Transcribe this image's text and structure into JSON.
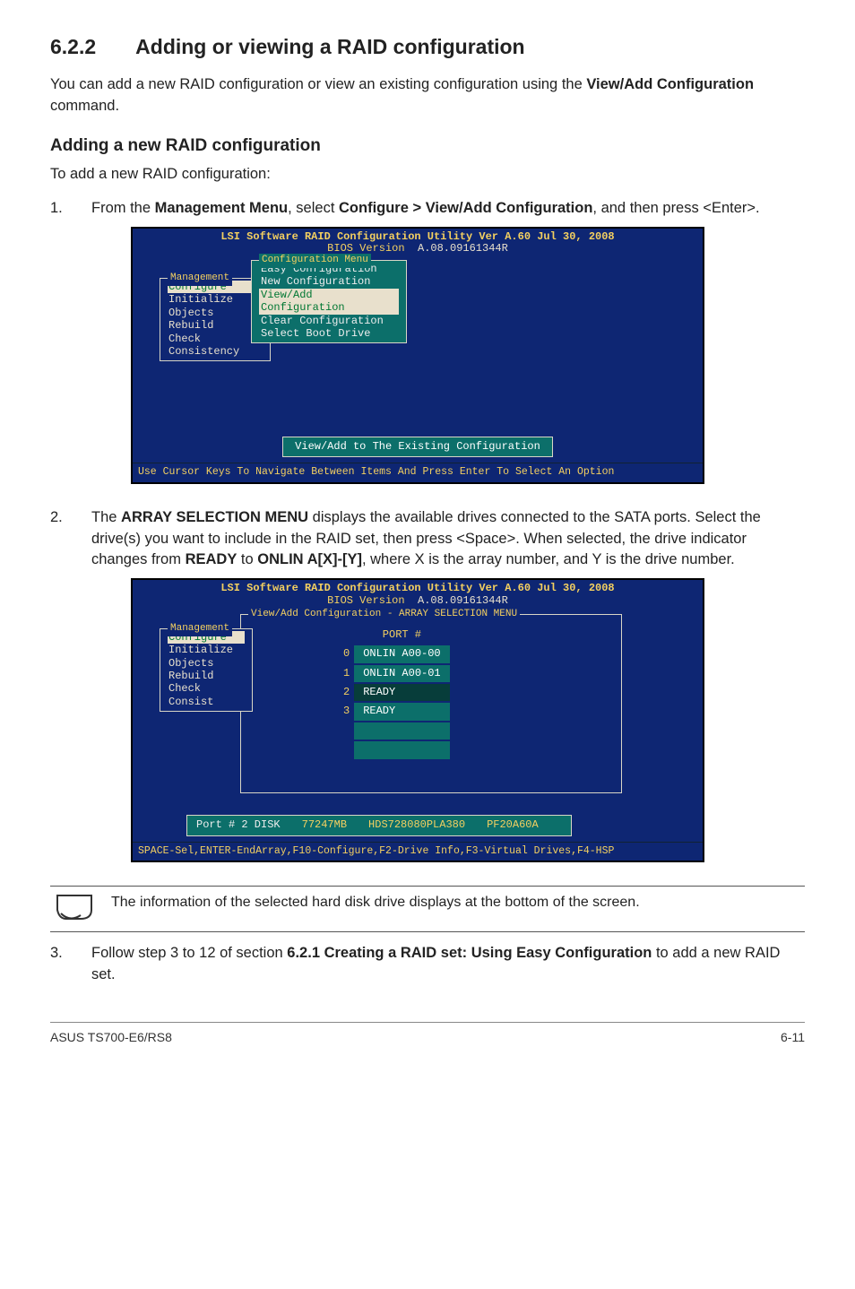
{
  "heading": {
    "number": "6.2.2",
    "title": "Adding or viewing a RAID configuration"
  },
  "intro": {
    "p1a": "You can add a new RAID configuration or view an existing configuration using the ",
    "p1bold": "View/Add Configuration",
    "p1b": " command."
  },
  "sub": {
    "title": "Adding a new RAID configuration",
    "lead": "To add a new RAID configuration:"
  },
  "step1": {
    "num": "1.",
    "a": "From the ",
    "b1": "Management Menu",
    "b": ", select ",
    "b2": "Configure > View/Add Configuration",
    "c": ", and then press <Enter>."
  },
  "bios1": {
    "title": "LSI Software RAID Configuration Utility Ver A.60 Jul 30, 2008",
    "version": "BIOS Version  A.08.09161344R",
    "mgmt_label": "Management",
    "mgmt": [
      "Configure",
      "Initialize",
      "Objects",
      "Rebuild",
      "Check Consistency"
    ],
    "cfg_label": "Configuration Menu",
    "cfg": [
      "Easy Configuration",
      "New Configuration",
      "View/Add Configuration",
      "Clear Configuration",
      "Select Boot Drive"
    ],
    "status": "View/Add to The Existing Configuration",
    "help": "Use Cursor Keys To Navigate Between Items And Press Enter To Select An Option"
  },
  "step2": {
    "num": "2.",
    "a": "The ",
    "b1": "ARRAY SELECTION MENU",
    "b": " displays the available drives connected to the SATA ports. Select the drive(s) you want to include in the RAID set, then press <Space>. When selected, the drive indicator changes from ",
    "b2": "READY",
    "c": " to ",
    "b3": "ONLIN A[X]-[Y]",
    "d": ", where X is the array number, and Y is the drive number."
  },
  "bios2": {
    "title": "LSI Software RAID Configuration Utility Ver A.60 Jul 30, 2008",
    "version": "BIOS Version  A.08.09161344R",
    "view_label": "View/Add Configuration - ARRAY SELECTION MENU",
    "mgmt_label": "Management",
    "mgmt": [
      "Configure",
      "Initialize",
      "Objects",
      "Rebuild",
      "Check Consist"
    ],
    "port_header": "PORT #",
    "rows": [
      {
        "i": "0",
        "v": "ONLIN A00-00"
      },
      {
        "i": "1",
        "v": "ONLIN A00-01"
      },
      {
        "i": "2",
        "v": "READY"
      },
      {
        "i": "3",
        "v": "READY"
      }
    ],
    "status": {
      "a": "Port # 2 DISK",
      "b": "77247MB",
      "c": "HDS728080PLA380",
      "d": "PF20A60A"
    },
    "help": "SPACE-Sel,ENTER-EndArray,F10-Configure,F2-Drive Info,F3-Virtual Drives,F4-HSP"
  },
  "note": "The information of the selected hard disk drive displays at the bottom of the screen.",
  "step3": {
    "num": "3.",
    "a": "Follow step 3 to 12 of section ",
    "b1": "6.2.1 Creating a RAID set: Using Easy Configuration",
    "b": " to add a new RAID set."
  },
  "footer": {
    "left": "ASUS TS700-E6/RS8",
    "right": "6-11"
  }
}
